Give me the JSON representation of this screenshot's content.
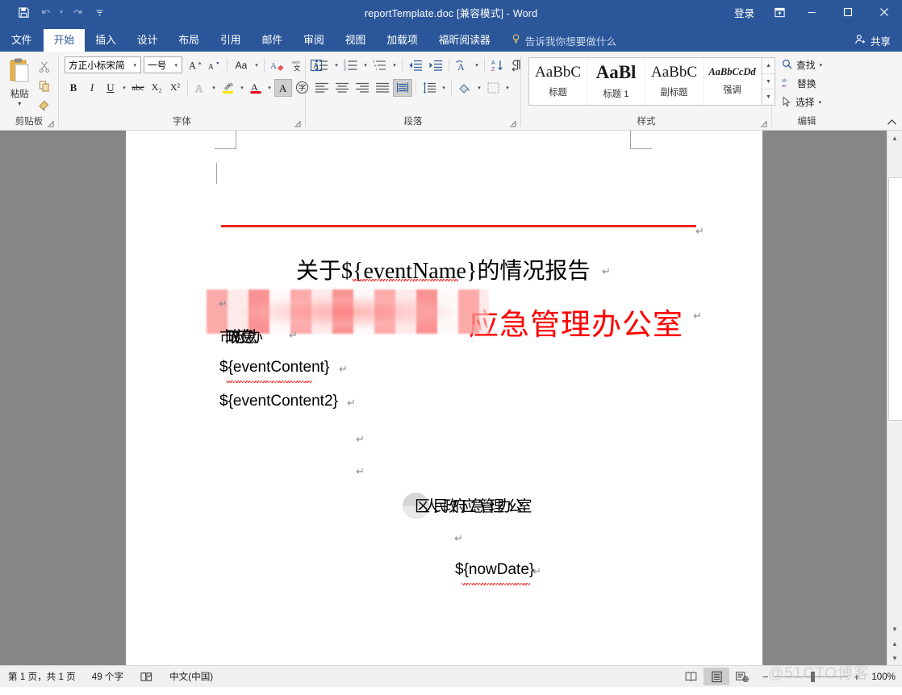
{
  "titlebar": {
    "quick_access": [
      {
        "name": "save",
        "label": "保存"
      },
      {
        "name": "undo",
        "label": "撤销"
      },
      {
        "name": "redo",
        "label": "恢复"
      },
      {
        "name": "customize",
        "label": "自定义快速访问工具栏"
      }
    ],
    "document_title": "reportTemplate.doc [兼容模式]  -  Word",
    "signin_label": "登录",
    "ribbon_display_label": "功能区显示选项",
    "minimize_label": "最小化",
    "maximize_label": "最大化",
    "close_label": "关闭"
  },
  "tabs": [
    {
      "label": "文件",
      "active": false
    },
    {
      "label": "开始",
      "active": true
    },
    {
      "label": "插入",
      "active": false
    },
    {
      "label": "设计",
      "active": false
    },
    {
      "label": "布局",
      "active": false
    },
    {
      "label": "引用",
      "active": false
    },
    {
      "label": "邮件",
      "active": false
    },
    {
      "label": "审阅",
      "active": false
    },
    {
      "label": "视图",
      "active": false
    },
    {
      "label": "加载项",
      "active": false
    },
    {
      "label": "福昕阅读器",
      "active": false
    }
  ],
  "tell_me": "告诉我你想要做什么",
  "share_label": "共享",
  "ribbon": {
    "clipboard": {
      "group_label": "剪贴板",
      "paste_label": "粘贴",
      "cut_label": "剪切",
      "copy_label": "复制",
      "format_painter_label": "格式刷"
    },
    "font": {
      "group_label": "字体",
      "font_name": "方正小标宋简",
      "font_size": "一号",
      "grow_font_label": "增大字号",
      "shrink_font_label": "减小字号",
      "change_case_label": "更改大小写",
      "clear_format_label": "清除所有格式",
      "phonetic_label": "拼音指南",
      "char_border_label": "字符边框",
      "bold_label": "B",
      "italic_label": "I",
      "underline_label": "U",
      "strikethrough_label": "abc",
      "subscript_label": "X₂",
      "superscript_label": "X²",
      "text_effects_label": "文本效果和版式",
      "highlight_label": "文本突出显示颜色",
      "font_color_label": "字体颜色",
      "char_shading_label": "字符底纹",
      "enclose_char_label": "带圈字符"
    },
    "paragraph": {
      "group_label": "段落",
      "bullets_label": "项目符号",
      "numbering_label": "编号",
      "multilevel_label": "多级列表",
      "decrease_indent_label": "减少缩进量",
      "increase_indent_label": "增加缩进量",
      "cn_layout_label": "中文版式",
      "sort_label": "排序",
      "show_marks_label": "显示/隐藏编辑标记",
      "align_left_label": "左对齐",
      "align_center_label": "居中",
      "align_right_label": "右对齐",
      "justify_label": "两端对齐",
      "distribute_label": "分散对齐",
      "line_spacing_label": "行和段落间距",
      "shading_label": "底纹",
      "borders_label": "边框"
    },
    "styles": {
      "group_label": "样式",
      "items": [
        {
          "preview": "AaBbC",
          "name": "标题",
          "style": "title"
        },
        {
          "preview": "AaBl",
          "name": "标题 1",
          "style": "heading1"
        },
        {
          "preview": "AaBbC",
          "name": "副标题",
          "style": "subtitle"
        },
        {
          "preview": "AaBbCcDd",
          "name": "强调",
          "style": "emphasis"
        }
      ]
    },
    "editing": {
      "group_label": "编辑",
      "find_label": "查找",
      "replace_label": "替换",
      "select_label": "选择"
    },
    "collapse_label": "折叠功能区"
  },
  "document": {
    "header_redacted_text": "",
    "header_red_text": "应急管理办公室",
    "title_line": {
      "prefix": "关于$",
      "placeholder": "{eventName}",
      "suffix": "的情况报告"
    },
    "salutation": "市政府应急办:",
    "paragraphs": [
      "${eventContent}",
      "${eventContent2}"
    ],
    "signature": "区人民政府应急管理办公室",
    "date_placeholder": "${nowDate}",
    "pilcrow": "↵"
  },
  "status_bar": {
    "page_info": "第 1 页，共 1 页",
    "word_count": "49 个字",
    "proofing_label": "校对",
    "language": "中文(中国)",
    "view_read_label": "阅读视图",
    "view_print_label": "页面视图",
    "view_web_label": "Web 版式视图",
    "zoom_out_label": "缩小",
    "zoom_in_label": "放大",
    "zoom_level": "100%",
    "watermark": "@51CTO博客"
  },
  "colors": {
    "brand_blue": "#2b579a",
    "header_red": "#ff0000",
    "rule_red": "#e8271f",
    "ribbon_bg": "#f5f5f5",
    "page_bg": "#868686"
  }
}
